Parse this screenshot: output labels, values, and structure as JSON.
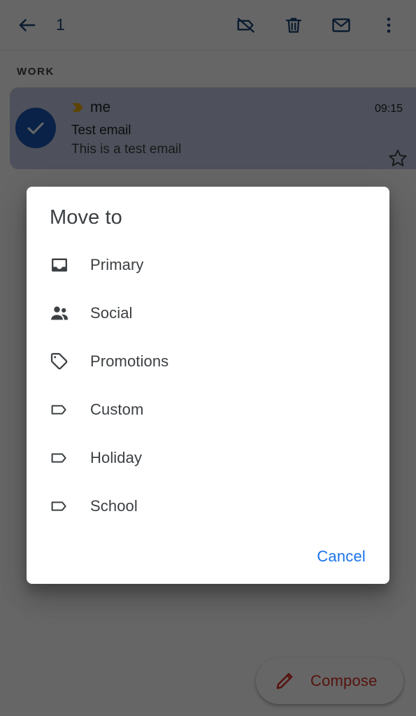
{
  "appbar": {
    "back_icon": "arrow-back-icon",
    "selection_count": "1",
    "actions": [
      {
        "name": "label-off-icon",
        "label": "Remove label"
      },
      {
        "name": "delete-icon",
        "label": "Delete"
      },
      {
        "name": "mail-icon",
        "label": "Mark as unread"
      },
      {
        "name": "more-vert-icon",
        "label": "More options"
      }
    ]
  },
  "list": {
    "section_header": "WORK",
    "email": {
      "selected": true,
      "avatar_icon": "check-icon",
      "importance_marker": "importance-chevron-icon",
      "sender": "me",
      "subject": "Test email",
      "snippet": "This is a test email",
      "time": "09:15",
      "star_icon": "star-outline-icon",
      "starred": false
    }
  },
  "compose": {
    "icon": "pencil-icon",
    "label": "Compose",
    "color": "#d93025"
  },
  "dialog": {
    "title": "Move to",
    "items": [
      {
        "label": "Primary",
        "icon": "inbox-icon"
      },
      {
        "label": "Social",
        "icon": "people-icon"
      },
      {
        "label": "Promotions",
        "icon": "local-offer-icon"
      },
      {
        "label": "Custom",
        "icon": "label-outline-icon"
      },
      {
        "label": "Holiday",
        "icon": "label-outline-icon"
      },
      {
        "label": "School",
        "icon": "label-outline-icon"
      }
    ],
    "cancel_label": "Cancel",
    "cancel_color": "#1a73e8"
  },
  "theme": {
    "scrim": "#636363",
    "accent_blue": "#1a73e8",
    "avatar_blue": "#1a56b5",
    "importance_yellow": "#e8a700",
    "text_primary": "#202124",
    "text_secondary": "#3c4043"
  }
}
